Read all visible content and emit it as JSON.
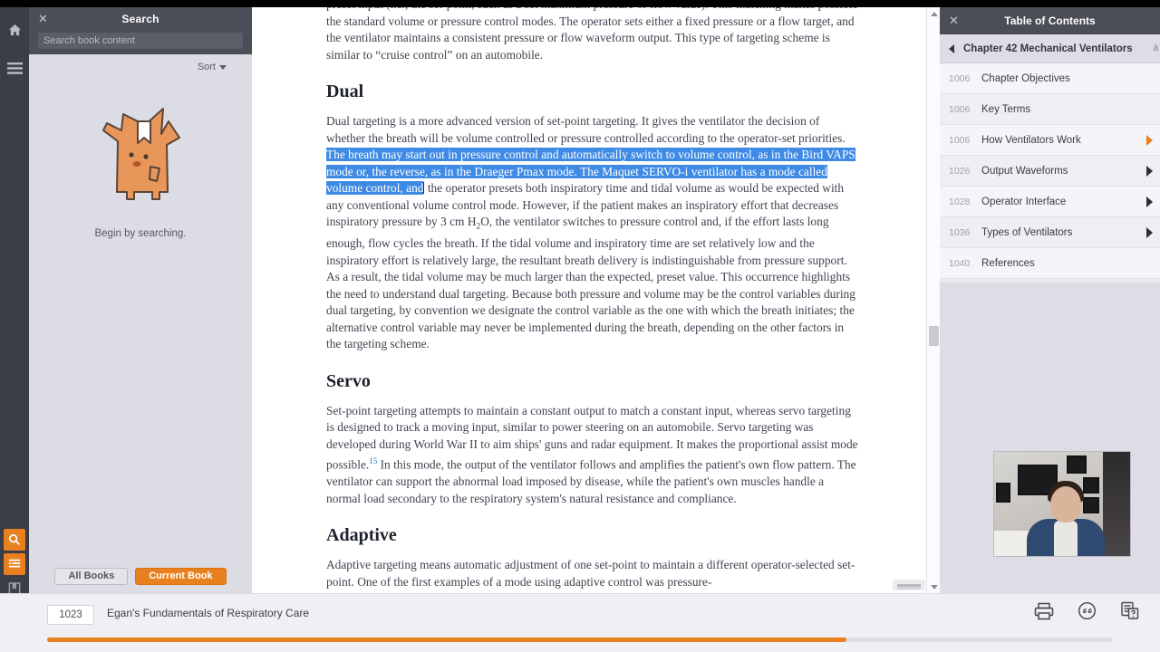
{
  "app": {
    "rail": {
      "home_icon": "home-icon",
      "menu_icon": "hamburger-menu-icon",
      "search_icon": "search-icon",
      "notes_icon": "notes-list-icon",
      "bookmark_icon": "bookmark-icon",
      "copy_icon": "copy-pages-icon"
    }
  },
  "search_panel": {
    "title": "Search",
    "close_label": "✕",
    "input_placeholder": "Search book content",
    "input_value": "",
    "sort_label": "Sort",
    "empty_message": "Begin by searching.",
    "mascot_icon": "mascot-waving-icon",
    "scope_buttons": [
      {
        "label": "All Books",
        "active": false
      },
      {
        "label": "Current Book",
        "active": true
      }
    ]
  },
  "reader": {
    "para_top": "preset input (i.e., the set-point, such as a set maximum pressure or flow value). This matching makes possible the standard volume or pressure control modes. The operator sets either a fixed pressure or a flow target, and the ventilator maintains a consistent pressure or flow waveform output. This type of targeting scheme is similar to “cruise control” on an automobile.",
    "heading_dual": "Dual",
    "dual_before_highlight": "Dual targeting is a more advanced version of set-point targeting. It gives the ventilator the decision of whether the breath will be volume controlled or pressure controlled according to the operator-set priorities. ",
    "dual_highlight": "The breath may start out in pressure control and automatically switch to volume control, as in the Bird VAPS mode or, the reverse, as in the Draeger Pmax mode. The Maquet SERVO-i ventilator has a mode called volume control, and",
    "dual_after_highlight": " the operator presets both inspiratory time and tidal volume as would be expected with any conventional volume control mode. However, if the patient makes an inspiratory effort that decreases inspiratory pressure by 3 cm H",
    "dual_sub": "2",
    "dual_after_sub": "O, the ventilator switches to pressure control and, if the effort lasts long enough, flow cycles the breath. If the tidal volume and inspiratory time are set relatively low and the inspiratory effort is relatively large, the resultant breath delivery is indistinguishable from pressure support. As a result, the tidal volume may be much larger than the expected, preset value. This occurrence highlights the need to understand dual targeting. Because both pressure and volume may be the control variables during dual targeting, by convention we designate the control variable as the one with which the breath initiates; the alternative control variable may never be implemented during the breath, depending on the other factors in the targeting scheme.",
    "heading_servo": "Servo",
    "servo_part1": "Set-point targeting attempts to maintain a constant output to match a constant input, whereas servo targeting is designed to track a moving input, similar to power steering on an automobile. Servo targeting was developed during World War II to aim ships' guns and radar equipment. It makes the proportional assist mode possible.",
    "servo_ref": "15",
    "servo_part2": " In this mode, the output of the ventilator follows and amplifies the patient's own flow pattern. The ventilator can support the abnormal load imposed by disease, while the patient's own muscles handle a normal load secondary to the respiratory system's natural resistance and compliance.",
    "heading_adaptive": "Adaptive",
    "adaptive_para": "Adaptive targeting means automatic adjustment of one set-point to maintain a different operator-selected set-point. One of the first examples of a mode using adaptive control was pressure-"
  },
  "toc": {
    "title": "Table of Contents",
    "close_label": "✕",
    "back_icon": "chevron-left-icon",
    "chapter": "Chapter 42 Mechanical Ventilators",
    "chapter_cut": "à",
    "items": [
      {
        "page": "1006",
        "label": "Chapter Objectives",
        "has_chevron": false,
        "chevron_active": false
      },
      {
        "page": "1006",
        "label": "Key Terms",
        "has_chevron": false,
        "chevron_active": false
      },
      {
        "page": "1006",
        "label": "How Ventilators Work",
        "has_chevron": true,
        "chevron_active": true
      },
      {
        "page": "1026",
        "label": "Output Waveforms",
        "has_chevron": true,
        "chevron_active": false
      },
      {
        "page": "1028",
        "label": "Operator Interface",
        "has_chevron": true,
        "chevron_active": false
      },
      {
        "page": "1036",
        "label": "Types of Ventilators",
        "has_chevron": true,
        "chevron_active": false
      },
      {
        "page": "1040",
        "label": "References",
        "has_chevron": false,
        "chevron_active": false
      }
    ]
  },
  "webcam": {
    "label": "webcam-video-overlay"
  },
  "bottom": {
    "page_number": "1023",
    "book_title": "Egan's Fundamentals of Respiratory Care",
    "progress_percent": 75,
    "print_icon": "printer-icon",
    "cite_icon": "quotation-cite-icon",
    "notes_icon": "document-help-icon"
  },
  "colors": {
    "accent": "#e8801f",
    "highlight": "#3e8ae4",
    "panel_dark": "#4b4d57",
    "rail": "#3b3d47"
  }
}
